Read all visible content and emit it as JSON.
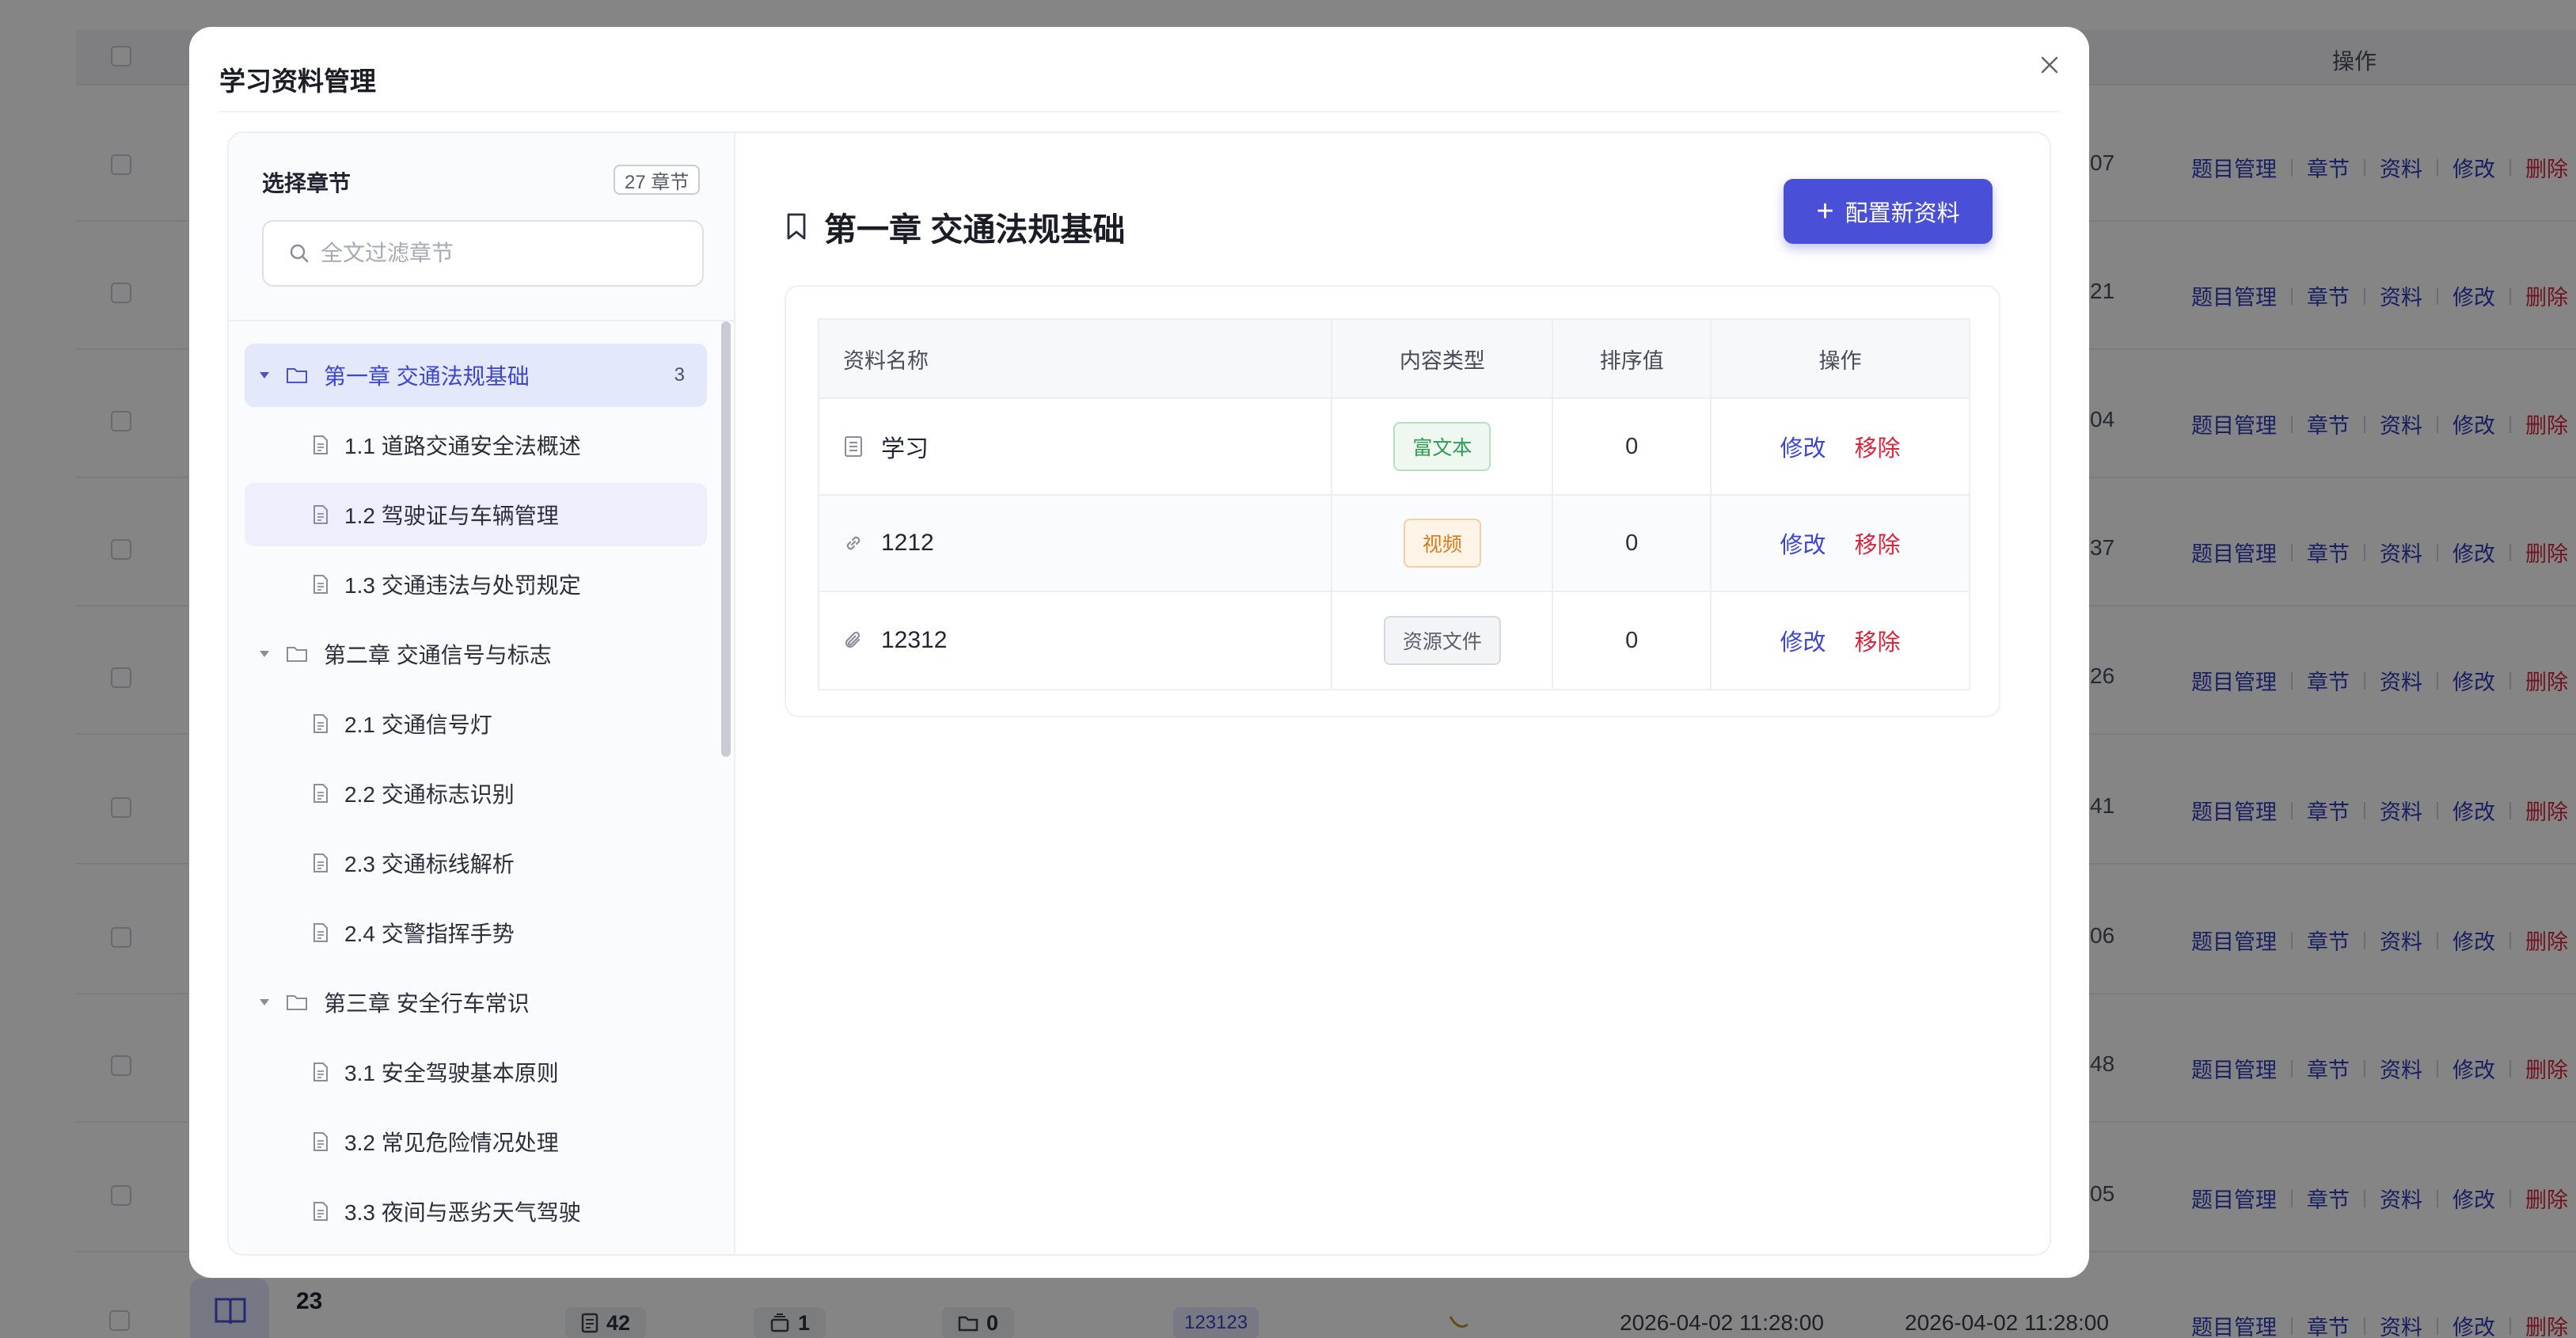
{
  "background": {
    "header_action": "操作",
    "rows": [
      {
        "date_tail": "07"
      },
      {
        "date_tail": "21"
      },
      {
        "date_tail": "04"
      },
      {
        "date_tail": "37"
      },
      {
        "date_tail": "26"
      },
      {
        "date_tail": "41"
      },
      {
        "date_tail": "06"
      },
      {
        "date_tail": "48"
      },
      {
        "date_tail": "05"
      }
    ],
    "row_actions": {
      "questions": "题目管理",
      "chapters": "章节",
      "materials": "资料",
      "edit": "修改",
      "delete": "删除"
    },
    "last_row": {
      "name": "23",
      "docs": "42",
      "items": "1",
      "folders": "0",
      "tag": "123123",
      "created": "2026-04-02 11:28:00",
      "updated": "2026-04-02 11:28:00"
    }
  },
  "modal": {
    "title": "学习资料管理",
    "left": {
      "title": "选择章节",
      "count": "27 章节",
      "search_placeholder": "全文过滤章节",
      "tree": [
        {
          "type": "chapter",
          "label": "第一章 交通法规基础",
          "count": "3",
          "active": true
        },
        {
          "type": "section",
          "label": "1.1 道路交通安全法概述"
        },
        {
          "type": "section",
          "label": "1.2 驾驶证与车辆管理",
          "hover": true
        },
        {
          "type": "section",
          "label": "1.3 交通违法与处罚规定"
        },
        {
          "type": "chapter",
          "label": "第二章 交通信号与标志"
        },
        {
          "type": "section",
          "label": "2.1 交通信号灯"
        },
        {
          "type": "section",
          "label": "2.2 交通标志识别"
        },
        {
          "type": "section",
          "label": "2.3 交通标线解析"
        },
        {
          "type": "section",
          "label": "2.4 交警指挥手势"
        },
        {
          "type": "chapter",
          "label": "第三章 安全行车常识"
        },
        {
          "type": "section",
          "label": "3.1 安全驾驶基本原则"
        },
        {
          "type": "section",
          "label": "3.2 常见危险情况处理"
        },
        {
          "type": "section",
          "label": "3.3 夜间与恶劣天气驾驶"
        }
      ]
    },
    "right": {
      "section_title": "第一章 交通法规基础",
      "add_button": "配置新资料",
      "columns": {
        "name": "资料名称",
        "type": "内容类型",
        "sort": "排序值",
        "actions": "操作"
      },
      "rows": [
        {
          "name": "学习",
          "icon": "document-icon",
          "type": "富文本",
          "type_color": "green",
          "sort": "0"
        },
        {
          "name": "1212",
          "icon": "link-icon",
          "type": "视频",
          "type_color": "orange",
          "sort": "0"
        },
        {
          "name": "12312",
          "icon": "paperclip-icon",
          "type": "资源文件",
          "type_color": "gray",
          "sort": "0"
        }
      ],
      "edit_label": "修改",
      "remove_label": "移除"
    },
    "colors": {
      "accent": "#4a4fd8",
      "danger": "#d8243d",
      "success": "#2f9a55",
      "warning": "#d97a17"
    }
  }
}
